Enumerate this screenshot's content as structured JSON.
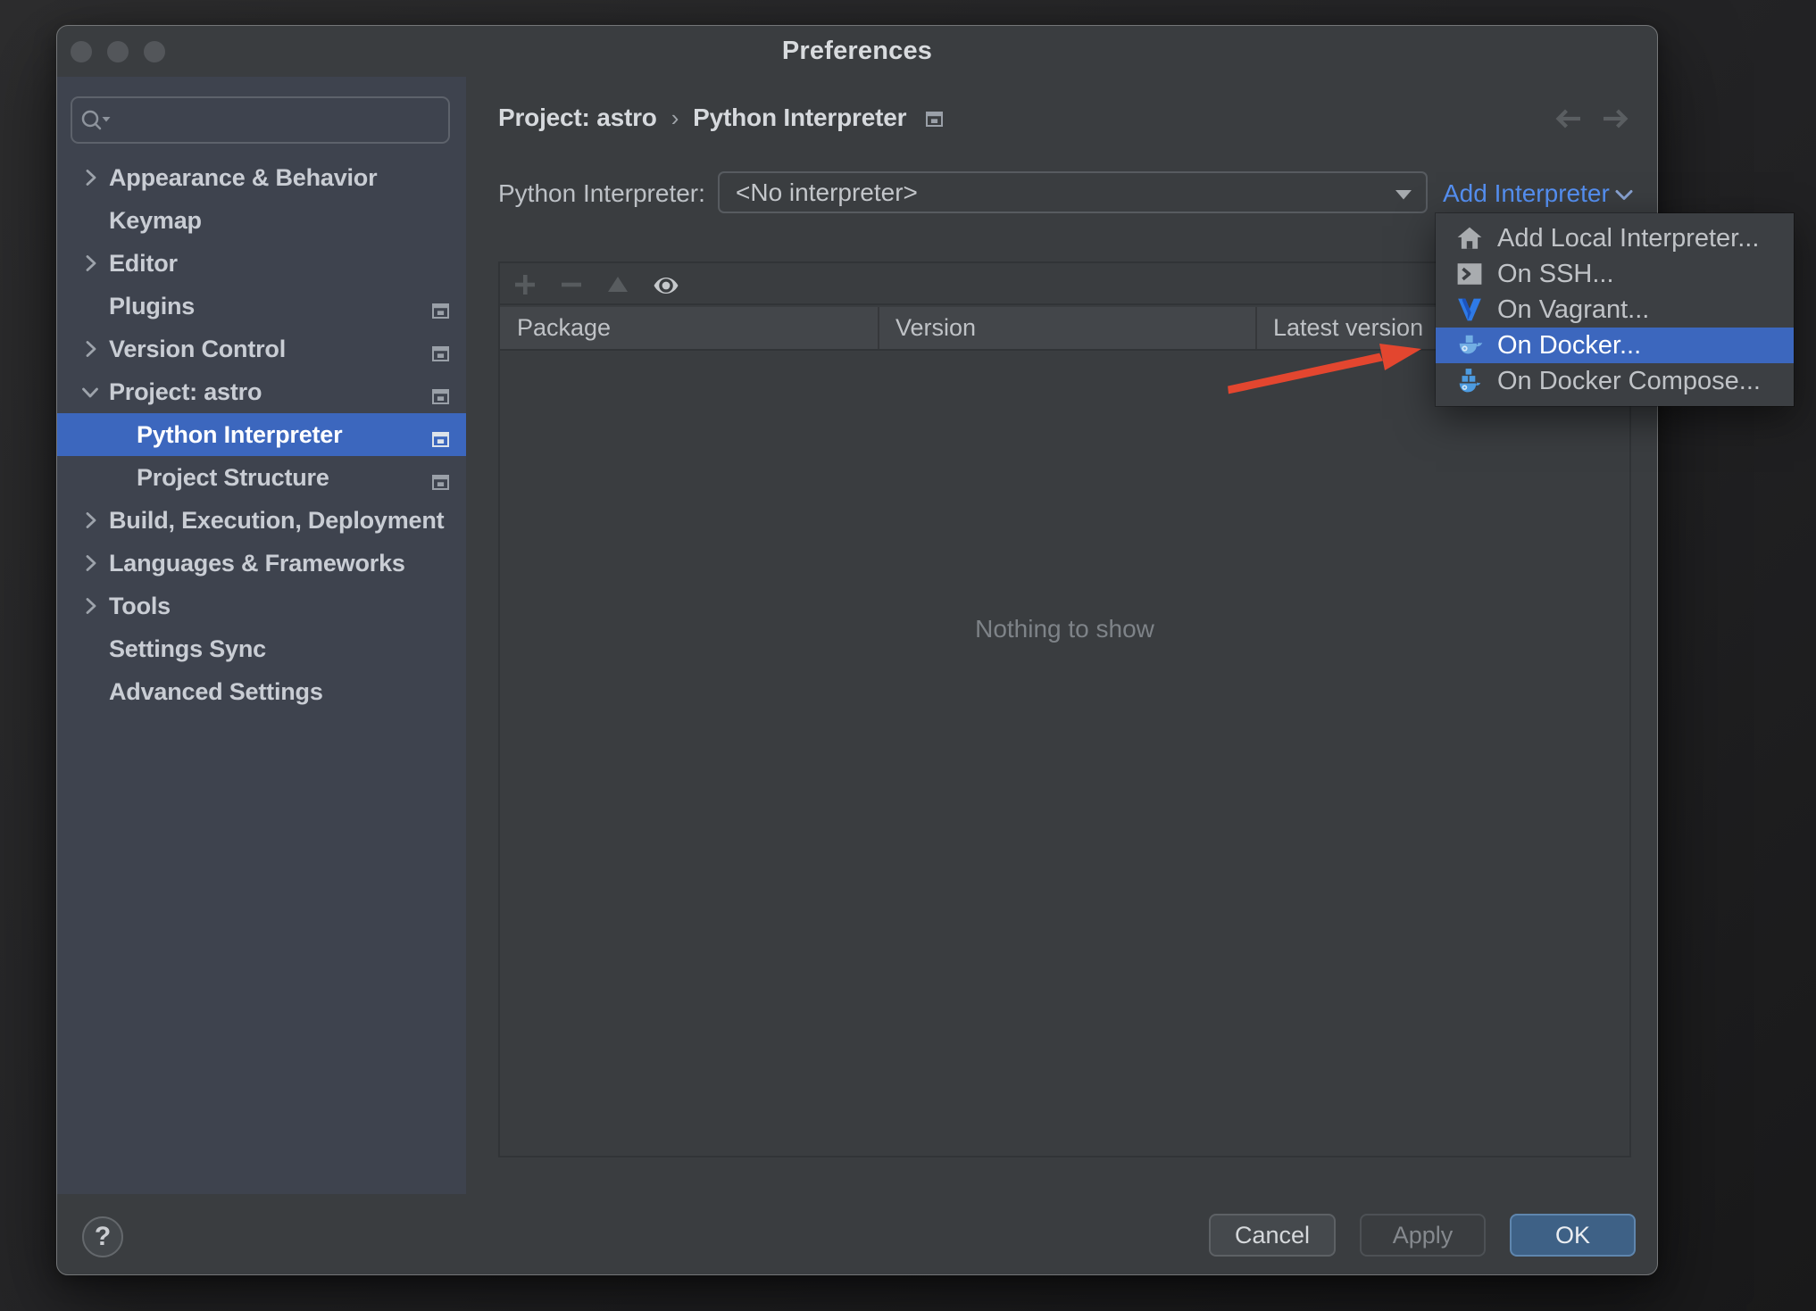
{
  "window": {
    "title": "Preferences"
  },
  "sidebar": {
    "search_value": "",
    "items": [
      {
        "label": "Appearance & Behavior",
        "chevron": "right",
        "frame_icon": false,
        "child": false,
        "selected": false
      },
      {
        "label": "Keymap",
        "chevron": "none",
        "frame_icon": false,
        "child": false,
        "selected": false
      },
      {
        "label": "Editor",
        "chevron": "right",
        "frame_icon": false,
        "child": false,
        "selected": false
      },
      {
        "label": "Plugins",
        "chevron": "none",
        "frame_icon": true,
        "child": false,
        "selected": false
      },
      {
        "label": "Version Control",
        "chevron": "right",
        "frame_icon": true,
        "child": false,
        "selected": false
      },
      {
        "label": "Project: astro",
        "chevron": "down",
        "frame_icon": true,
        "child": false,
        "selected": false
      },
      {
        "label": "Python Interpreter",
        "chevron": "none",
        "frame_icon": true,
        "child": true,
        "selected": true
      },
      {
        "label": "Project Structure",
        "chevron": "none",
        "frame_icon": true,
        "child": true,
        "selected": false
      },
      {
        "label": "Build, Execution, Deployment",
        "chevron": "right",
        "frame_icon": false,
        "child": false,
        "selected": false
      },
      {
        "label": "Languages & Frameworks",
        "chevron": "right",
        "frame_icon": false,
        "child": false,
        "selected": false
      },
      {
        "label": "Tools",
        "chevron": "right",
        "frame_icon": false,
        "child": false,
        "selected": false
      },
      {
        "label": "Settings Sync",
        "chevron": "none",
        "frame_icon": false,
        "child": false,
        "selected": false
      },
      {
        "label": "Advanced Settings",
        "chevron": "none",
        "frame_icon": false,
        "child": false,
        "selected": false
      }
    ]
  },
  "breadcrumb": {
    "project": "Project: astro",
    "separator": "›",
    "page": "Python Interpreter"
  },
  "interpreter": {
    "label": "Python Interpreter:",
    "value": "<No interpreter>",
    "add_link": "Add Interpreter"
  },
  "menu": {
    "items": [
      {
        "label": "Add Local Interpreter...",
        "icon": "home",
        "selected": false
      },
      {
        "label": "On SSH...",
        "icon": "ssh",
        "selected": false
      },
      {
        "label": "On Vagrant...",
        "icon": "vagrant",
        "selected": false
      },
      {
        "label": "On Docker...",
        "icon": "docker",
        "selected": true
      },
      {
        "label": "On Docker Compose...",
        "icon": "docker-compose",
        "selected": false
      }
    ]
  },
  "table": {
    "columns": [
      "Package",
      "Version",
      "Latest version"
    ],
    "rows": [],
    "empty_text": "Nothing to show"
  },
  "footer": {
    "help": "?",
    "cancel": "Cancel",
    "apply": "Apply",
    "ok": "OK"
  },
  "colors": {
    "selection": "#3c67be",
    "link": "#5590f2",
    "ok_button": "#3e6186",
    "arrow": "#e3462f"
  }
}
